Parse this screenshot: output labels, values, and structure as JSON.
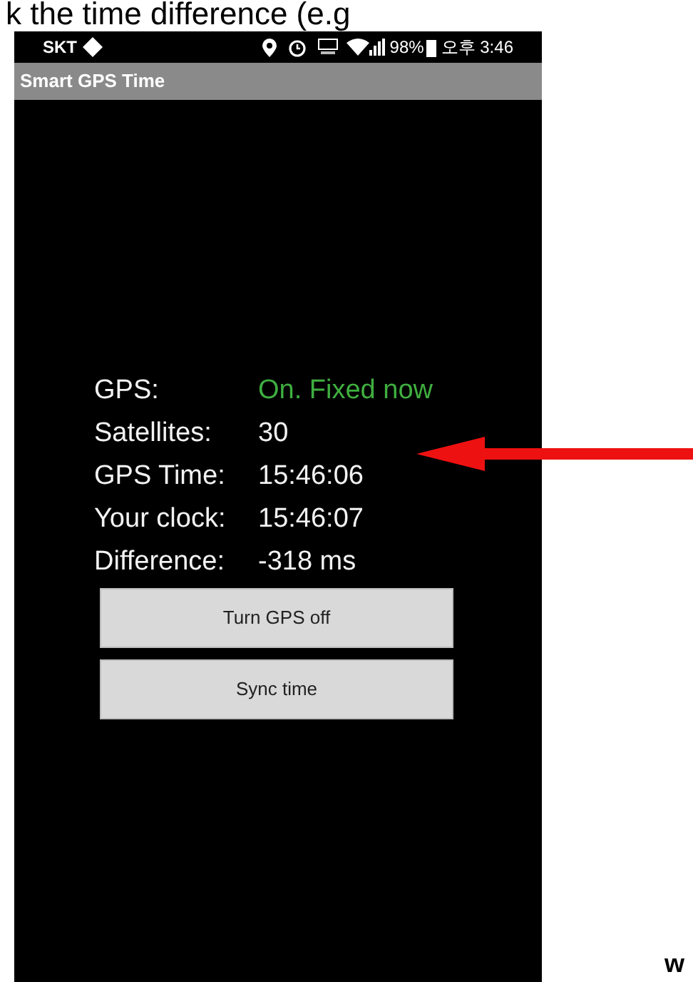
{
  "caption": "k the time difference (e.g",
  "status_bar": {
    "carrier": "SKT",
    "battery": "98%",
    "time": "오후 3:46"
  },
  "app_bar": {
    "title": "Smart GPS Time"
  },
  "info_rows": [
    {
      "label": "GPS:",
      "value": "On. Fixed now",
      "kind": "status"
    },
    {
      "label": "Satellites:",
      "value": "30",
      "kind": "plain"
    },
    {
      "label": "GPS Time:",
      "value": "15:46:06",
      "kind": "plain"
    },
    {
      "label": "Your clock:",
      "value": "15:46:07",
      "kind": "plain"
    },
    {
      "label": "Difference:",
      "value": "-318 ms",
      "kind": "plain"
    }
  ],
  "buttons": [
    "Turn GPS off",
    "Sync time"
  ],
  "footer_text": "w"
}
